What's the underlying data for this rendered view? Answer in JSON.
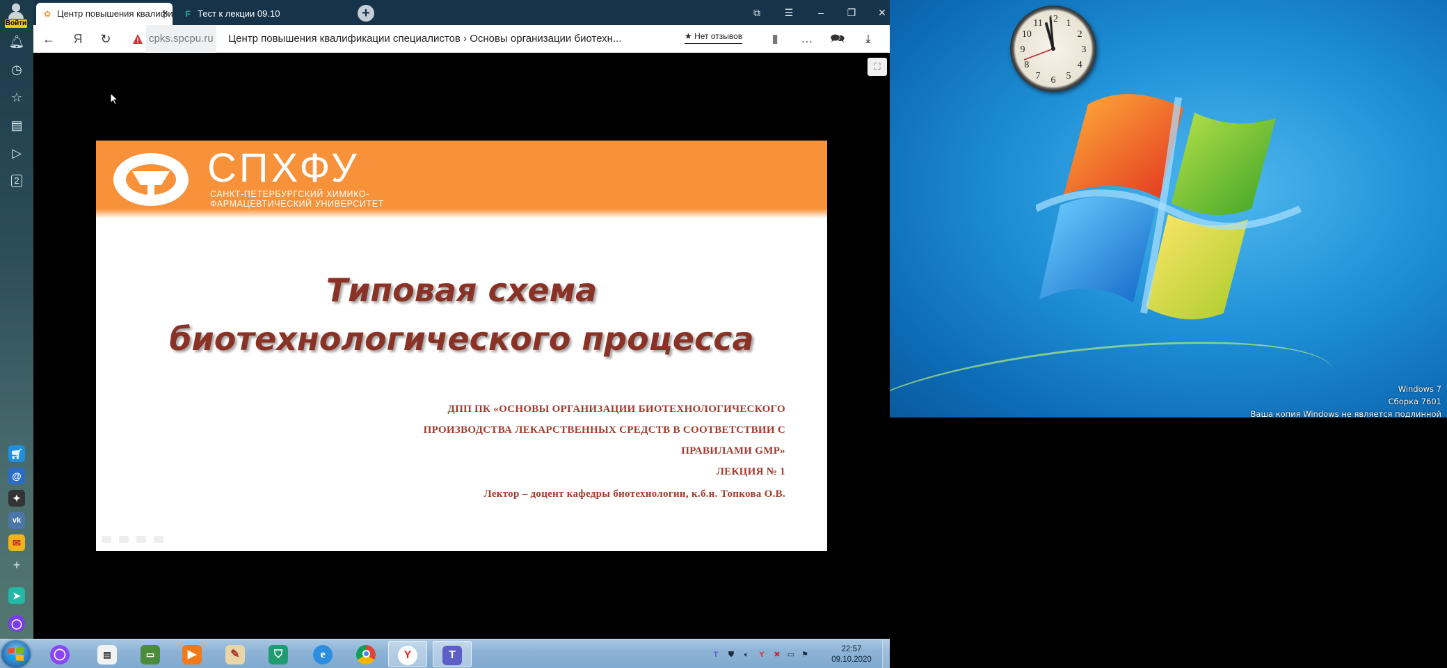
{
  "browser": {
    "login_label": "Войти",
    "tabs": [
      {
        "label": "Центр повышения квалификации специалистов",
        "favicon": "spcpu-favicon",
        "active": true
      },
      {
        "label": "Тест к лекции 09.10",
        "favicon": "forms-favicon",
        "active": false
      }
    ],
    "new_tab_glyph": "+",
    "address": {
      "host": "cpks.spcpu.ru",
      "title": "Центр повышения квалификации специалистов › Основы организации биотехн...",
      "reviews_label": "Нет отзывов",
      "ya_glyph": "Я"
    },
    "sidebar_badge": "2"
  },
  "slide": {
    "logo_name": "СПХФУ",
    "logo_line1": "САНКТ-ПЕТЕРБУРГСКИЙ ХИМИКО-",
    "logo_line2": "ФАРМАЦЕВТИЧЕСКИЙ УНИВЕРСИТЕТ",
    "title_line1": "Типовая схема",
    "title_line2": "биотехнологического процесса",
    "sub_line1": "ДПП ПК «ОСНОВЫ ОРГАНИЗАЦИИ БИОТЕХНОЛОГИЧЕСКОГО",
    "sub_line2": "ПРОИЗВОДСТВА ЛЕКАРСТВЕННЫХ СРЕДСТВ В СООТВЕТСТВИИ С",
    "sub_line3": "ПРАВИЛАМИ GMP»",
    "sub_line4": "ЛЕКЦИЯ № 1",
    "sub_line5": "Лектор – доцент кафедры биотехнологии, к.б.н. Топкова О.В.",
    "header_color": "#f7923a",
    "title_color": "#8a3226"
  },
  "desktop": {
    "watermark_line1": "Windows 7",
    "watermark_line2": "Сборка 7601",
    "watermark_line3": "Ваша копия Windows не является подлинной",
    "clock_numbers": [
      "12",
      "1",
      "2",
      "3",
      "4",
      "5",
      "6",
      "7",
      "8",
      "9",
      "10",
      "11"
    ]
  },
  "taskbar": {
    "time": "22:57",
    "date": "09.10.2020",
    "apps": [
      "alice",
      "notepad",
      "task-manager",
      "media-player",
      "paint",
      "kaspersky",
      "internet-explorer",
      "chrome",
      "yandex-browser",
      "teams"
    ]
  }
}
